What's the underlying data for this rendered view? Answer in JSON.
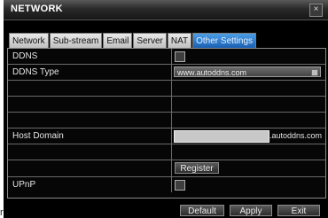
{
  "window": {
    "title": "NETWORK",
    "close_glyph": "×"
  },
  "outer_char": "r",
  "tabs": [
    {
      "label": "Network",
      "active": false
    },
    {
      "label": "Sub-stream",
      "active": false
    },
    {
      "label": "Email",
      "active": false
    },
    {
      "label": "Server",
      "active": false
    },
    {
      "label": "NAT",
      "active": false
    },
    {
      "label": "Other Settings",
      "active": true
    }
  ],
  "form": {
    "ddns_label": "DDNS",
    "ddns_checked": false,
    "ddns_type_label": "DDNS Type",
    "ddns_type_value": "www.autoddns.com",
    "host_domain_label": "Host Domain",
    "host_domain_value": "",
    "host_domain_suffix": ".autoddns.com",
    "register_label": "Register",
    "upnp_label": "UPnP",
    "upnp_checked": false
  },
  "footer": {
    "default_label": "Default",
    "apply_label": "Apply",
    "exit_label": "Exit"
  },
  "colors": {
    "active_tab": "#1a5fb2",
    "panel_bg": "#060606",
    "title_bg": "#2a2a2a"
  }
}
